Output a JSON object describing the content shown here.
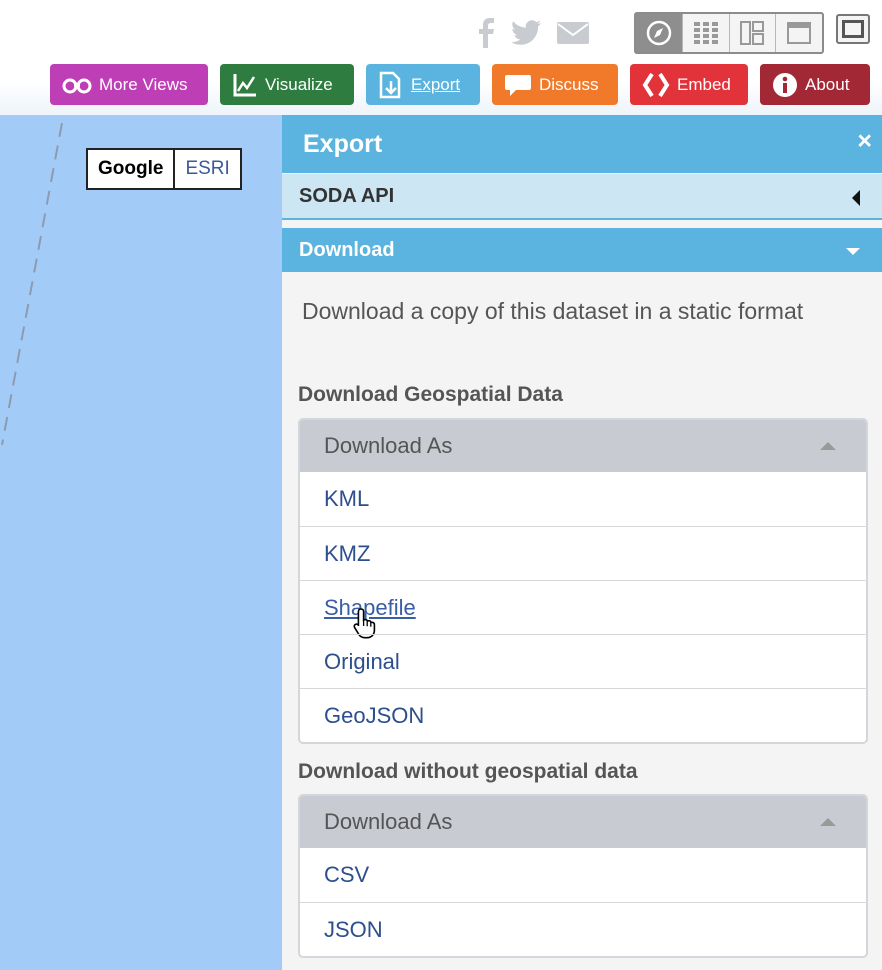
{
  "social": {
    "facebook_icon": "facebook-icon",
    "twitter_icon": "twitter-icon",
    "email_icon": "email-icon"
  },
  "view_modes": [
    "compass-icon",
    "grid-icon",
    "layout-icon",
    "page-icon"
  ],
  "actions": [
    {
      "label": "More Views",
      "icon": "binoculars-icon",
      "color": "#be3fb5"
    },
    {
      "label": "Visualize",
      "icon": "chart-icon",
      "color": "#2e7c3f"
    },
    {
      "label": "Export",
      "icon": "export-icon",
      "color": "#5bb4df"
    },
    {
      "label": "Discuss",
      "icon": "speech-bubble-icon",
      "color": "#f07a2a"
    },
    {
      "label": "Embed",
      "icon": "code-braces-icon",
      "color": "#e2323a"
    },
    {
      "label": "About",
      "icon": "info-icon",
      "color": "#a12834"
    }
  ],
  "map": {
    "layers": {
      "google": "Google",
      "esri": "ESRI"
    }
  },
  "panel": {
    "title": "Export",
    "close": "×",
    "soda_api": "SODA API",
    "download": "Download",
    "description": "Download a copy of this dataset in a static format",
    "geo_section": {
      "title": "Download Geospatial Data",
      "dropdown_label": "Download As",
      "items": [
        "KML",
        "KMZ",
        "Shapefile",
        "Original",
        "GeoJSON"
      ]
    },
    "nongeo_section": {
      "title": "Download without geospatial data",
      "dropdown_label": "Download As",
      "items": [
        "CSV",
        "JSON"
      ]
    }
  }
}
